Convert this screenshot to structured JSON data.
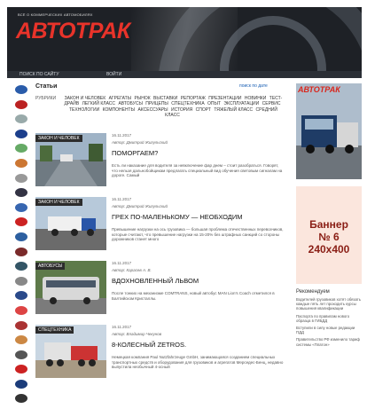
{
  "header": {
    "tagline": "ВСЁ О КОММЕРЧЕСКИХ АВТОМОБИЛЯХ",
    "logo": "АВТОТРАК",
    "nav": [
      "ПОИСК ПО САЙТУ",
      "ВОЙТИ"
    ]
  },
  "main": {
    "section_title": "Статьи",
    "search_link": "поиск по дате",
    "rubrics_label": "РУБРИКИ",
    "categories": [
      "ЗАКОН И ЧЕЛОВЕК",
      "АГРЕГАТЫ",
      "РЫНОК",
      "ВЫСТАВКИ",
      "РЕПОРТАЖ",
      "ПРЕЗЕНТАЦИИ",
      "НОВИНКИ",
      "ТЕСТ-ДРАЙВ",
      "ЛЕГКИЙ КЛАСС",
      "АВТОБУСЫ",
      "ПРИЦЕПЫ",
      "СПЕЦТЕХНИКА",
      "ОПЫТ",
      "ЭКСПЛУАТАЦИИ",
      "СЕРВИС",
      "ТЕХНОЛОГИИ",
      "КОМПОНЕНТЫ",
      "АКСЕССУАРЫ",
      "ИСТОРИЯ",
      "СПОРТ",
      "ТЯЖЕЛЫЙ КЛАСС",
      "СРЕДНИЙ КЛАСС"
    ],
    "articles": [
      {
        "badge": "ЗАКОН И ЧЕЛОВЕК",
        "date": "16.11.2017",
        "author": "Автор: Дмитрий Жигульский",
        "title": "ПОМОРГАЕМ?",
        "lead": "Есть ли наказание для водителя за невключение фар днем – стоит разобраться. Говорят, что нельзя дальнобойщикам предлагать специальный вид обучения световым сигналам на дороге. Самый"
      },
      {
        "badge": "ЗАКОН И ЧЕЛОВЕК",
        "date": "16.11.2017",
        "author": "Автор: Дмитрий Жигульский",
        "title": "ГРЕХ ПО-МАЛЕНЬКОМУ — НЕОБХОДИМ",
        "lead": "Превышение нагрузки на ось грузовика — большая проблема отечественных перевозчиков, которые считают, что превышение нагрузки на 15-20% без штрафных санкций со стороны дорожников станет много"
      },
      {
        "badge": "АВТОБУСЫ",
        "date": "16.11.2017",
        "author": "Автор: Карасев А. В.",
        "title": "ВДОХНОВЛЕННЫЙ ЛЬВОМ",
        "lead": "После тонких на механизме COMTRANS, новый автобус MAN Lion's Coach отметился в Балтийском Кристаллы."
      },
      {
        "badge": "СПЕЦТЕХНИКА",
        "date": "16.11.2017",
        "author": "Автор: Владимир Чекунов",
        "title": "8-КОЛЕСНЫЙ ZETROS.",
        "lead": "Немецкая компания Paul Nutzfahrzeuge GmbH, занимающаяся созданием специальных транспортных средств и оборудования для грузовиков и агрегатов Мерседес-Бенц, недавно выпустила необычный 4-осный"
      }
    ]
  },
  "right": {
    "magazine_logo": "АВТОТРАК",
    "banner": [
      "Баннер",
      "№ 6",
      "240x400"
    ],
    "news_title": "Рекомендуем",
    "news": [
      "Водителей грузовиков хотят обязать каждые пять лет проходить курсы повышения квалификации",
      "Паспорта по правилам нового образца в ГИБДД",
      "Вступили в силу новые редакции ПДД",
      "Правительство РФ изменило тариф системы «Платон»"
    ]
  },
  "colors": {
    "accent": "#e8332a",
    "link": "#1a5fb4",
    "header_bg": "#1e2126",
    "banner_bg": "#fbe6dd"
  }
}
